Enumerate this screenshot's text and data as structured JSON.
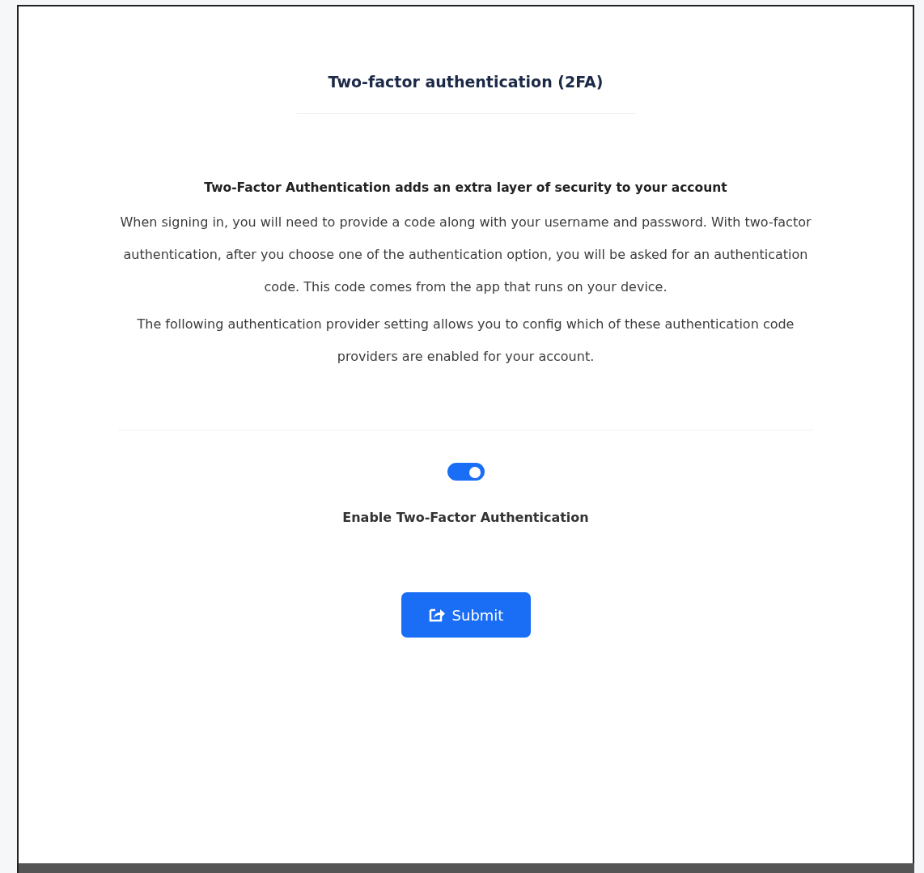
{
  "title": "Two-factor authentication (2FA)",
  "intro": {
    "heading": "Two-Factor Authentication adds an extra layer of security to your account",
    "paragraphs": [
      "When signing in, you will need to provide a code along with your username and password. With two-factor authentication, after you choose one of the authentication option, you will be asked for an authentication code. This code comes from the app that runs on your device.",
      "The following authentication provider setting allows you to config which of these authentication code providers are enabled for your account."
    ]
  },
  "toggle": {
    "on": true,
    "label": "Enable Two-Factor Authentication"
  },
  "submit": {
    "label": "Submit"
  }
}
